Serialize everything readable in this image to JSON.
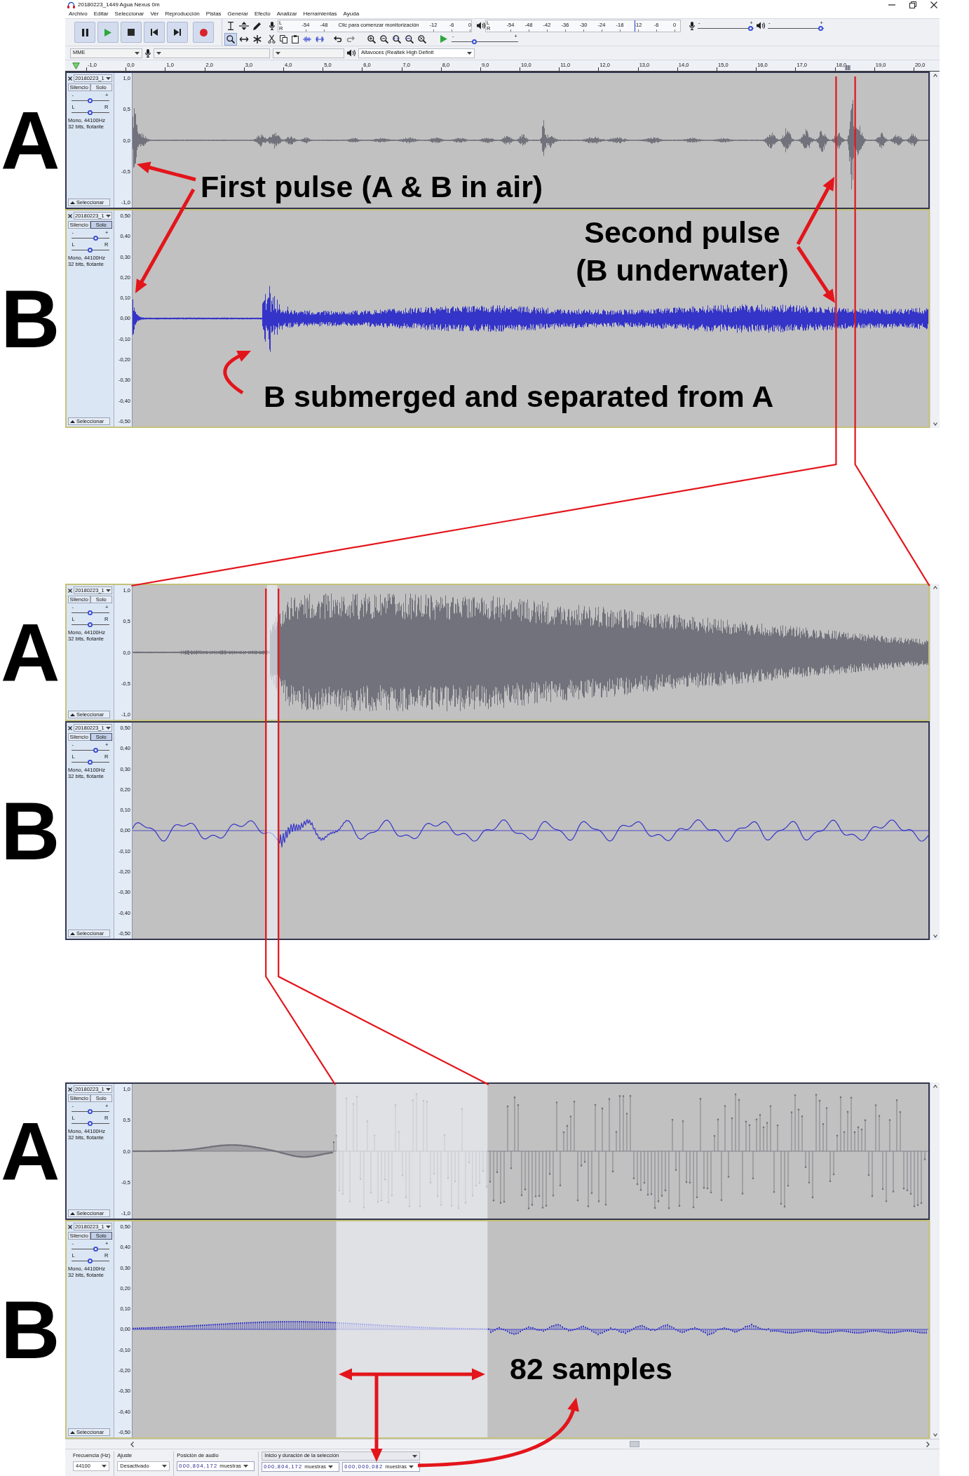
{
  "window": {
    "title": "20180223_1449 Agua Nexus 0m"
  },
  "menu": [
    "Archivo",
    "Editar",
    "Seleccionar",
    "Ver",
    "Reproducción",
    "Pistas",
    "Generar",
    "Efecto",
    "Analizar",
    "Herramientas",
    "Ayuda"
  ],
  "tools": [
    {
      "kind": "select",
      "selected": false
    },
    {
      "kind": "envelope",
      "selected": false
    },
    {
      "kind": "draw",
      "selected": false
    },
    {
      "kind": "zoom",
      "selected": true
    },
    {
      "kind": "timeshift",
      "selected": false
    },
    {
      "kind": "multi",
      "selected": false
    }
  ],
  "meters": [
    {
      "kind": "record",
      "channels": [
        "L",
        "R"
      ],
      "scale": [
        {
          "kind": "tick",
          "text": "-54"
        },
        {
          "kind": "tick",
          "text": "-48"
        },
        {
          "kind": "prompt",
          "text": "Clic para comenzar monitorización"
        },
        {
          "kind": "tick",
          "text": "-12"
        },
        {
          "kind": "tick",
          "text": "-6"
        },
        {
          "kind": "tick",
          "text": "0"
        }
      ]
    },
    {
      "kind": "playback",
      "channels": [
        "L",
        "R"
      ],
      "level": 0.78,
      "scale": [
        {
          "kind": "tick",
          "text": "-54"
        },
        {
          "kind": "tick",
          "text": "-48"
        },
        {
          "kind": "tick",
          "text": "-42"
        },
        {
          "kind": "tick",
          "text": "-36"
        },
        {
          "kind": "tick",
          "text": "-30"
        },
        {
          "kind": "tick",
          "text": "-24"
        },
        {
          "kind": "tick",
          "text": "-18"
        },
        {
          "kind": "tick",
          "text": "-12"
        },
        {
          "kind": "tick",
          "text": "-6"
        },
        {
          "kind": "tick",
          "text": "0"
        }
      ]
    }
  ],
  "mixer": [
    {
      "kind": "record",
      "marks": [
        "-",
        "+"
      ],
      "level": 0.98
    },
    {
      "kind": "playback",
      "marks": [
        "-",
        "+"
      ],
      "level": 0.98
    }
  ],
  "play_at_speed": {
    "marks": [
      "-",
      "+"
    ],
    "level": 0.33
  },
  "devices": [
    {
      "kind": "host",
      "value": "MME"
    },
    {
      "kind": "input"
    },
    {
      "kind": "channels"
    },
    {
      "kind": "output",
      "value": "Altavoces (Realtek High Definit"
    }
  ],
  "timeline": {
    "ticks": [
      "-1,0",
      "0,0",
      "1,0",
      "2,0",
      "3,0",
      "4,0",
      "5,0",
      "6,0",
      "7,0",
      "8,0",
      "9,0",
      "10,0",
      "11,0",
      "12,0",
      "13,0",
      "14,0",
      "15,0",
      "16,0",
      "17,0",
      "18,0",
      "19,0",
      "20,0"
    ]
  },
  "panels": [
    {
      "kind": "overview",
      "selected_region": false,
      "tracks": [
        {
          "label": "A",
          "name": "20180223_1",
          "focused": false,
          "kind": "pulses",
          "color": "#72727c",
          "buttons": [
            {
              "text": "Silencio",
              "on": false
            },
            {
              "text": "Solo",
              "on": false
            }
          ],
          "gain": {
            "marks": [
              "-",
              "+"
            ],
            "level": 0.49
          },
          "pan": {
            "marks": [
              "L",
              "R"
            ],
            "level": 0.49
          },
          "info": [
            "Mono, 44100Hz",
            "32 bits, flotante"
          ],
          "select": "Seleccionar",
          "scale": [
            "1,0",
            "0,5",
            "0,0",
            "-0,5",
            "-1,0"
          ]
        },
        {
          "label": "B",
          "name": "20180223_1",
          "focused": true,
          "kind": "burst",
          "color": "#3434c8",
          "buttons": [
            {
              "text": "Silencio",
              "on": false
            },
            {
              "text": "Solo",
              "on": true
            }
          ],
          "gain": {
            "marks": [
              "-",
              "+"
            ],
            "level": 0.67
          },
          "pan": {
            "marks": [
              "L",
              "R"
            ],
            "level": 0.49
          },
          "info": [
            "Mono, 44100Hz",
            "32 bits, flotante"
          ],
          "select": "Seleccionar",
          "scale": [
            "0,50",
            "0,40",
            "0,30",
            "0,20",
            "0,10",
            "0,00",
            "-0,10",
            "-0,20",
            "-0,30",
            "-0,40",
            "-0,50"
          ]
        }
      ]
    },
    {
      "kind": "zoom",
      "selected_region": true,
      "tracks": [
        {
          "label": "A",
          "name": "20180223_1",
          "focused": true,
          "kind": "decay",
          "color": "#72727c",
          "buttons": [
            {
              "text": "Silencio",
              "on": false
            },
            {
              "text": "Solo",
              "on": false
            }
          ],
          "gain": {
            "marks": [
              "-",
              "+"
            ],
            "level": 0.49
          },
          "pan": {
            "marks": [
              "L",
              "R"
            ],
            "level": 0.49
          },
          "info": [
            "Mono, 44100Hz",
            "32 bits, flotante"
          ],
          "select": "Seleccionar",
          "scale": [
            "1,0",
            "0,5",
            "0,0",
            "-0,5",
            "-1,0"
          ]
        },
        {
          "label": "B",
          "name": "20180223_1",
          "focused": false,
          "kind": "ripple",
          "color": "#3434c8",
          "buttons": [
            {
              "text": "Silencio",
              "on": false
            },
            {
              "text": "Solo",
              "on": true
            }
          ],
          "gain": {
            "marks": [
              "-",
              "+"
            ],
            "level": 0.67
          },
          "pan": {
            "marks": [
              "L",
              "R"
            ],
            "level": 0.49
          },
          "info": [
            "Mono, 44100Hz",
            "32 bits, flotante"
          ],
          "select": "Seleccionar",
          "scale": [
            "0,50",
            "0,40",
            "0,30",
            "0,20",
            "0,10",
            "0,00",
            "-0,10",
            "-0,20",
            "-0,30",
            "-0,40",
            "-0,50"
          ]
        }
      ]
    },
    {
      "kind": "samples",
      "selected_region": true,
      "tracks": [
        {
          "label": "A",
          "name": "20180223_1",
          "focused": false,
          "kind": "stems",
          "color": "#72727c",
          "buttons": [
            {
              "text": "Silencio",
              "on": false
            },
            {
              "text": "Solo",
              "on": false
            }
          ],
          "gain": {
            "marks": [
              "-",
              "+"
            ],
            "level": 0.49
          },
          "pan": {
            "marks": [
              "L",
              "R"
            ],
            "level": 0.49
          },
          "info": [
            "Mono, 44100Hz",
            "32 bits, flotante"
          ],
          "select": "Seleccionar",
          "scale": [
            "1,0",
            "0,5",
            "0,0",
            "-0,5",
            "-1,0"
          ]
        },
        {
          "label": "B",
          "name": "20180223_1",
          "focused": true,
          "kind": "smooth_stems",
          "color": "#3434c8",
          "buttons": [
            {
              "text": "Silencio",
              "on": false
            },
            {
              "text": "Solo",
              "on": true
            }
          ],
          "gain": {
            "marks": [
              "-",
              "+"
            ],
            "level": 0.67
          },
          "pan": {
            "marks": [
              "L",
              "R"
            ],
            "level": 0.49
          },
          "info": [
            "Mono, 44100Hz",
            "32 bits, flotante"
          ],
          "select": "Seleccionar",
          "scale": [
            "0,50",
            "0,40",
            "0,30",
            "0,20",
            "0,10",
            "0,00",
            "-0,10",
            "-0,20",
            "-0,30",
            "-0,40",
            "-0,50"
          ]
        }
      ]
    }
  ],
  "selection_toolbar": [
    {
      "kind": "dropdown",
      "label": "Frecuencia (Hz)",
      "value": "44100"
    },
    {
      "kind": "dropdown",
      "label": "Ajuste",
      "value": "Desactivado"
    },
    {
      "kind": "time",
      "label": "Posición de audio",
      "fields": [
        {
          "value": "000,804,172",
          "unit": "muestras"
        }
      ]
    },
    {
      "kind": "time_mode",
      "label": "Inicio y duración de la selección",
      "fields": [
        {
          "value": "000,804,172",
          "unit": "muestras"
        },
        {
          "value": "000,000,082",
          "unit": "muestras"
        }
      ]
    }
  ],
  "annotations": [
    {
      "kind": "first_pulse",
      "text": "First pulse (A & B in air)"
    },
    {
      "kind": "second_pulse",
      "text": "Second pulse (B underwater)"
    },
    {
      "kind": "submerged",
      "text": "B submerged and separated from A"
    },
    {
      "kind": "samples",
      "text": "82 samples"
    }
  ]
}
